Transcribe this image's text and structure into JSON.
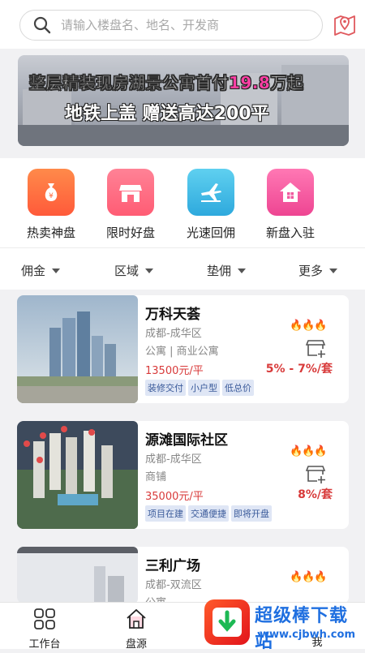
{
  "search": {
    "placeholder": "请输入楼盘名、地名、开发商"
  },
  "banner": {
    "line1_prefix": "整层精装现房湖景公寓首付",
    "line1_highlight": "19.8",
    "line1_suffix": "万起",
    "line2": "地铁上盖  赠送高达200平"
  },
  "quick": [
    {
      "label": "热卖神盘",
      "icon": "money-bag-icon",
      "color": "#ff6a3d"
    },
    {
      "label": "限时好盘",
      "icon": "shop-icon",
      "color": "#ff5f78"
    },
    {
      "label": "光速回佣",
      "icon": "plane-icon",
      "color": "#35b9e6"
    },
    {
      "label": "新盘入驻",
      "icon": "house-icon",
      "color": "#f24d9c"
    }
  ],
  "filters": [
    {
      "label": "佣金"
    },
    {
      "label": "区域"
    },
    {
      "label": "垫佣"
    },
    {
      "label": "更多"
    }
  ],
  "listings": [
    {
      "name": "万科天荟",
      "region": "成都-成华区",
      "type": "公寓 | 商业公寓",
      "price": "13500元/平",
      "tags": [
        "装修交付",
        "小户型",
        "低总价"
      ],
      "commission": "5% - 7%/套"
    },
    {
      "name": "源滩国际社区",
      "region": "成都-成华区",
      "type": "商铺",
      "price": "35000元/平",
      "tags": [
        "项目在建",
        "交通便捷",
        "即将开盘"
      ],
      "commission": "8%/套"
    },
    {
      "name": "三利广场",
      "region": "成都-双流区",
      "type": "公寓",
      "price": "",
      "tags": [],
      "commission": ""
    }
  ],
  "tabbar": [
    {
      "label": "工作台",
      "icon": "grid-icon"
    },
    {
      "label": "盘源",
      "icon": "home-icon"
    },
    {
      "label": "我",
      "icon": "user-icon"
    }
  ],
  "watermark": {
    "brand": "超级棒下载站",
    "url": "www.cjbwh.com"
  },
  "colors": {
    "accent": "#d83a3a",
    "tag_bg": "#dfe6f5",
    "tag_text": "#3a5a9a"
  }
}
